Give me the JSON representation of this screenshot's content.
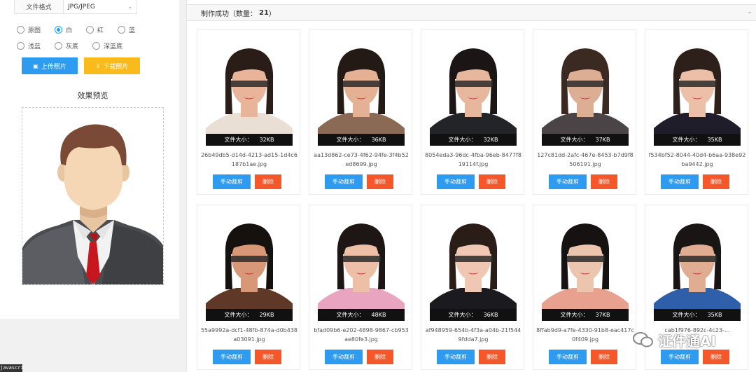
{
  "settings": {
    "format_label": "文件格式",
    "format_value": "JPG/JPEG",
    "backgrounds": [
      {
        "label": "原图",
        "selected": false
      },
      {
        "label": "白",
        "selected": true
      },
      {
        "label": "红",
        "selected": false
      },
      {
        "label": "蓝",
        "selected": false
      },
      {
        "label": "浅蓝",
        "selected": false
      },
      {
        "label": "灰底",
        "selected": false
      },
      {
        "label": "深蓝底",
        "selected": false
      }
    ],
    "upload_label": "上传照片",
    "download_label": "下载照片",
    "preview_title": "效果预览"
  },
  "status_bar": "javascript:;",
  "results": {
    "header_prefix": "制作成功（数量：",
    "count": "21",
    "header_suffix": "）",
    "size_label": "文件大小：",
    "crop_label": "手动裁剪",
    "delete_label": "删除",
    "items": [
      {
        "size": "32KB",
        "name": "26b49db5-d14d-4213-ad15-1d4c6187b1ae.jpg",
        "bg": "#ffffff",
        "hair": "#2a1d17",
        "skin": "#e8b49a",
        "cloth": "#eadfd5"
      },
      {
        "size": "36KB",
        "name": "aa13d862-ce73-4f62-94fe-3f4b52ed8699.jpg",
        "bg": "#ffffff",
        "hair": "#231a16",
        "skin": "#e4b195",
        "cloth": "#8a6a55"
      },
      {
        "size": "32KB",
        "name": "8054eda3-96dc-4fba-96eb-8477f819114f.jpg",
        "bg": "#ffffff",
        "hair": "#1b1515",
        "skin": "#e6b79d",
        "cloth": "#222428"
      },
      {
        "size": "37KB",
        "name": "127c81dd-2afc-467e-8453-b7d9f8506191.jpg",
        "bg": "#ffffff",
        "hair": "#3a2a21",
        "skin": "#dcae94",
        "cloth": "#4a4446"
      },
      {
        "size": "35KB",
        "name": "f534bf52-8044-40d4-b6aa-938e92ba9442.jpg",
        "bg": "#ffffff",
        "hair": "#2d1f19",
        "skin": "#ecc0a8",
        "cloth": "#1f1d2a"
      },
      {
        "size": "29KB",
        "name": "55a9992a-dcf1-48fb-874a-d0b438a03091.jpg",
        "bg": "#ffffff",
        "hair": "#15110f",
        "skin": "#d89878",
        "cloth": "#603828"
      },
      {
        "size": "48KB",
        "name": "bfad09b6-e202-4898-9867-cb953ae80fe3.jpg",
        "bg": "#ffffff",
        "hair": "#1e1614",
        "skin": "#ecbfa6",
        "cloth": "#e9a5c0"
      },
      {
        "size": "36KB",
        "name": "af948959-654b-4f3a-a04b-21f5449fdda7.jpg",
        "bg": "#ffffff",
        "hair": "#2a1d17",
        "skin": "#efc7b2",
        "cloth": "#1a1a1f"
      },
      {
        "size": "37KB",
        "name": "8ffab9d9-a7fe-4330-91b8-eac417c0f409.jpg",
        "bg": "#ffffff",
        "hair": "#171212",
        "skin": "#ecc5ae",
        "cloth": "#e7a18e"
      },
      {
        "size": "35KB",
        "name": "cab1f976-892c-4c23-...",
        "bg": "#ffffff",
        "hair": "#1a1515",
        "skin": "#e0ad93",
        "cloth": "#2f5fa8"
      }
    ]
  },
  "watermark": "证件通AI"
}
